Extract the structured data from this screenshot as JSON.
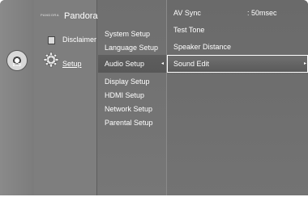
{
  "left_panel": {
    "dvd_label": "DVD",
    "pandora_small": "PANDORA",
    "pandora_label": "Pandora",
    "disclaimer_label": "Disclaimer",
    "setup_label": "Setup"
  },
  "setup_menu": {
    "items": [
      "System Setup",
      "Language Setup",
      "Audio Setup",
      "Display Setup",
      "HDMI Setup",
      "Network Setup",
      "Parental Setup"
    ],
    "selected": "Audio Setup"
  },
  "audio_submenu": {
    "items": [
      {
        "label": "AV Sync",
        "value": ": 50msec"
      },
      {
        "label": "Test Tone"
      },
      {
        "label": "Speaker Distance"
      },
      {
        "label": "Sound Edit"
      }
    ],
    "selected": "Sound Edit"
  },
  "icons": {
    "dvd": "disc-icon",
    "disclaimer": "document-icon",
    "setup": "gear-icon",
    "arrows": "arrow-left-right-icon"
  }
}
